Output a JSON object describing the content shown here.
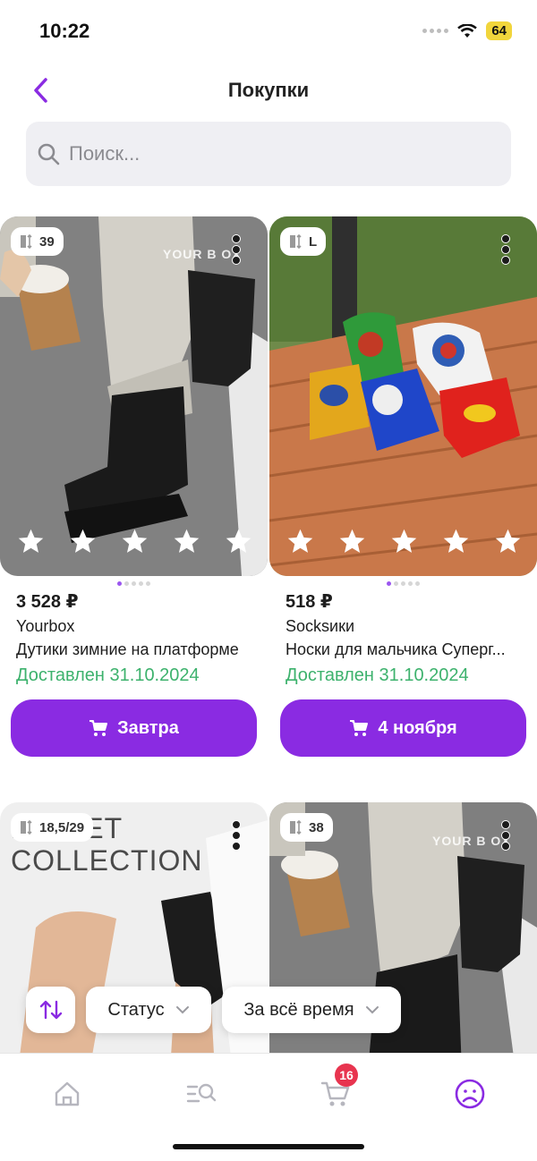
{
  "status_bar": {
    "time": "10:22",
    "battery": "64"
  },
  "header": {
    "title": "Покупки"
  },
  "search": {
    "placeholder": "Поиск..."
  },
  "products": [
    {
      "size": "39",
      "watermark": "YOUR B OX",
      "price": "3 528 ₽",
      "brand": "Yourbox",
      "name": "Дутики зимние на платформе",
      "status": "Доставлен 31.10.2024",
      "button": "Завтра"
    },
    {
      "size": "L",
      "price": "518 ₽",
      "brand": "Socksики",
      "name": "Носки для мальчика Суперг...",
      "status": "Доставлен 31.10.2024",
      "button": "4 ноября"
    },
    {
      "size": "18,5/29",
      "image_text": "BALLET COLLECTION"
    },
    {
      "size": "38",
      "watermark": "YOUR B OX"
    }
  ],
  "filters": {
    "status": "Статус",
    "period": "За всё время"
  },
  "bottom_nav": {
    "cart_count": "16"
  },
  "colors": {
    "accent": "#8a2be2",
    "delivered": "#3db26d",
    "badge": "#e8344f"
  }
}
